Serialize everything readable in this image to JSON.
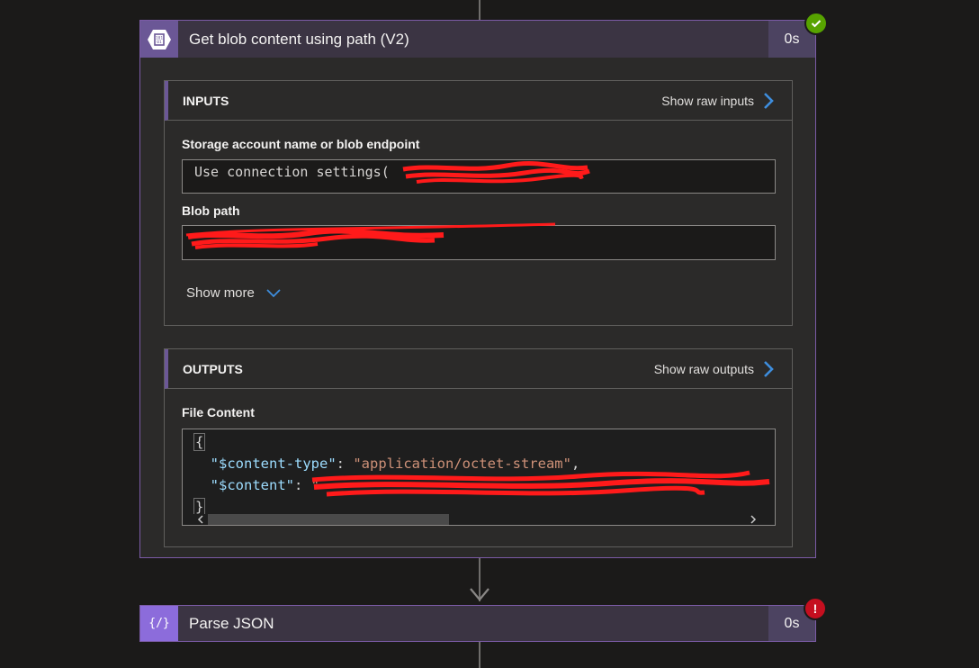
{
  "actions": {
    "get_blob": {
      "title": "Get blob content using path (V2)",
      "duration": "0s",
      "status": "succeeded",
      "icon": "blob-storage-icon",
      "inputs": {
        "header": "INPUTS",
        "raw_link": "Show raw inputs",
        "fields": [
          {
            "label": "Storage account name or blob endpoint",
            "value": "Use connection settings("
          },
          {
            "label": "Blob path",
            "value": ""
          }
        ],
        "show_more": "Show more"
      },
      "outputs": {
        "header": "OUTPUTS",
        "raw_link": "Show raw outputs",
        "file_content_label": "File Content",
        "json": {
          "open_brace": "{",
          "key1": "\"$content-type\"",
          "val1": "\"application/octet-stream\"",
          "key2": "\"$content\"",
          "val2": "\"",
          "close_brace": "}"
        }
      }
    },
    "parse_json": {
      "title": "Parse JSON",
      "duration": "0s",
      "status": "failed",
      "icon": "parse-json-icon",
      "icon_glyph": "{/}"
    }
  },
  "colors": {
    "accent_purple": "#7b5ba6",
    "success_green": "#57a300",
    "error_red": "#c50f1f",
    "link_blue": "#3e8ede"
  }
}
